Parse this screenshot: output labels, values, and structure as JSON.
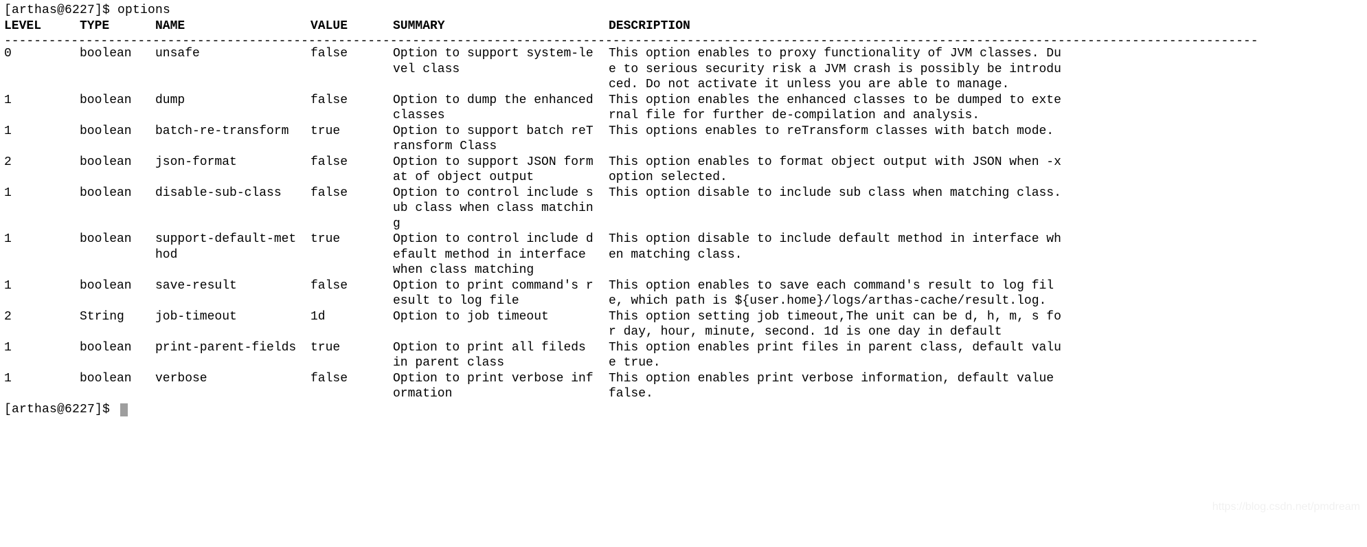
{
  "prompt_top": "[arthas@6227]$ options",
  "prompt_bottom": "[arthas@6227]$ ",
  "rule_line": "-------------------------------------------------------------------------------------------------------------------------------------------------------------------------",
  "watermark": "https://blog.csdn.net/pmdream",
  "headers": {
    "level": "LEVEL",
    "type": "TYPE",
    "name": "NAME",
    "value": "VALUE",
    "summary": "SUMMARY",
    "description": "DESCRIPTION"
  },
  "rows": [
    {
      "level": "0",
      "type": "boolean",
      "name": "unsafe",
      "value": "false",
      "summary": "Option to support system-level class",
      "description": "This option enables to proxy functionality of JVM classes. Due to serious security risk a JVM crash is possibly be introduced. Do not activate it unless you are able to manage."
    },
    {
      "level": "1",
      "type": "boolean",
      "name": "dump",
      "value": "false",
      "summary": "Option to dump the enhanced classes",
      "description": "This option enables the enhanced classes to be dumped to external file for further de-compilation and analysis."
    },
    {
      "level": "1",
      "type": "boolean",
      "name": "batch-re-transform",
      "value": "true",
      "summary": "Option to support batch reTransform Class",
      "description": "This options enables to reTransform classes with batch mode."
    },
    {
      "level": "2",
      "type": "boolean",
      "name": "json-format",
      "value": "false",
      "summary": "Option to support JSON format of object output",
      "description": "This option enables to format object output with JSON when -x option selected."
    },
    {
      "level": "1",
      "type": "boolean",
      "name": "disable-sub-class",
      "value": "false",
      "summary": "Option to control include sub class when class matching",
      "description": "This option disable to include sub class when matching class."
    },
    {
      "level": "1",
      "type": "boolean",
      "name": "support-default-method",
      "value": "true",
      "summary": "Option to control include default method in interface when class matching",
      "description": "This option disable to include default method in interface when matching class."
    },
    {
      "level": "1",
      "type": "boolean",
      "name": "save-result",
      "value": "false",
      "summary": "Option to print command's result to log file",
      "description": "This option enables to save each command's result to log file, which path is ${user.home}/logs/arthas-cache/result.log."
    },
    {
      "level": "2",
      "type": "String",
      "name": "job-timeout",
      "value": "1d",
      "summary": "Option to job timeout",
      "description": "This option setting job timeout,The unit can be d, h, m, s for day, hour, minute, second. 1d is one day in default"
    },
    {
      "level": "1",
      "type": "boolean",
      "name": "print-parent-fields",
      "value": "true",
      "summary": "Option to print all fileds in parent class",
      "description": "This option enables print files in parent class, default value true."
    },
    {
      "level": "1",
      "type": "boolean",
      "name": "verbose",
      "value": "false",
      "summary": "Option to print verbose information",
      "description": "This option enables print verbose information, default value false."
    }
  ]
}
